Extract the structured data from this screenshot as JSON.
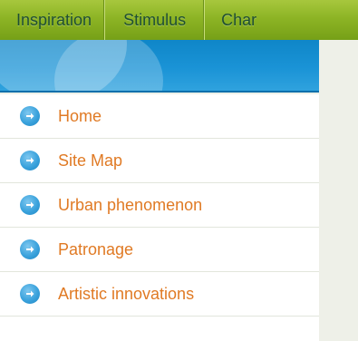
{
  "topnav": {
    "tabs": [
      {
        "label": "Inspiration"
      },
      {
        "label": "Stimulus"
      },
      {
        "label": "Char"
      }
    ]
  },
  "sidebar": {
    "items": [
      {
        "label": "Home",
        "icon": "arrow-right-icon"
      },
      {
        "label": "Site Map",
        "icon": "arrow-right-icon"
      },
      {
        "label": "Urban phenomenon",
        "icon": "arrow-right-icon"
      },
      {
        "label": "Patronage",
        "icon": "arrow-right-icon"
      },
      {
        "label": "Artistic innovations",
        "icon": "arrow-right-icon"
      }
    ]
  },
  "colors": {
    "nav_green": "#8db425",
    "banner_blue": "#1a93d6",
    "link_orange": "#e07a24",
    "bullet_blue": "#3aa2dc"
  }
}
